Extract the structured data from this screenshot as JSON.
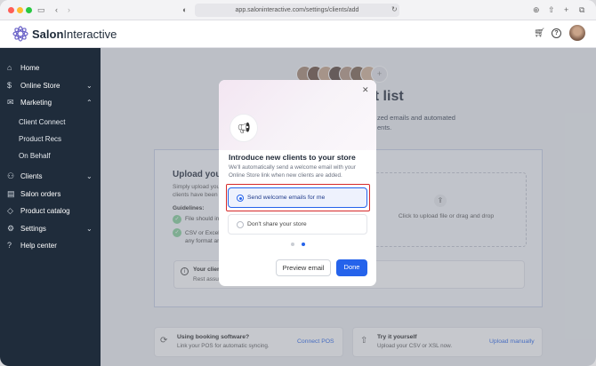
{
  "browser": {
    "url": "app.saloninteractive.com/settings/clients/add"
  },
  "brand": {
    "part1": "Salon",
    "part2": "Interactive"
  },
  "sidebar": {
    "home": "Home",
    "online_store": "Online Store",
    "marketing": "Marketing",
    "client_connect": "Client Connect",
    "product_recs": "Product Recs",
    "on_behalf": "On Behalf",
    "clients": "Clients",
    "salon_orders": "Salon orders",
    "product_catalog": "Product catalog",
    "settings": "Settings",
    "help_center": "Help center"
  },
  "page": {
    "title_visible": "nt list",
    "desc_line1": "zed emails and automated",
    "desc_line2": "ents.",
    "upload_heading": "Upload your",
    "upload_desc1": "Simply upload you",
    "upload_desc2": "clients have been",
    "guidelines_label": "Guidelines:",
    "guide1": "File should in",
    "guide2a": "CSV or Excel",
    "guide2b": "any format ar",
    "dropzone_text": "Click to upload file or drag and drop",
    "note_title": "Your client",
    "note_sub": "Rest assur",
    "pos_title": "Using booking software?",
    "pos_desc": "Link your POS for automatic syncing.",
    "pos_link": "Connect POS",
    "diy_title": "Try it yourself",
    "diy_desc": "Upload your CSV or XSL now.",
    "diy_link": "Upload manually"
  },
  "modal": {
    "title": "Introduce new clients to your store",
    "description": "We'll automatically send a welcome email with your Online Store link when new clients are added.",
    "option_send": "Send welcome emails for me",
    "option_dont": "Don't share your store",
    "selected": "Send welcome emails for me",
    "preview_button": "Preview email",
    "done_button": "Done",
    "close_glyph": "✕"
  },
  "colors": {
    "accent": "#2563eb",
    "sidebar_bg": "#1f2c3b",
    "highlight": "#d62a2a"
  }
}
